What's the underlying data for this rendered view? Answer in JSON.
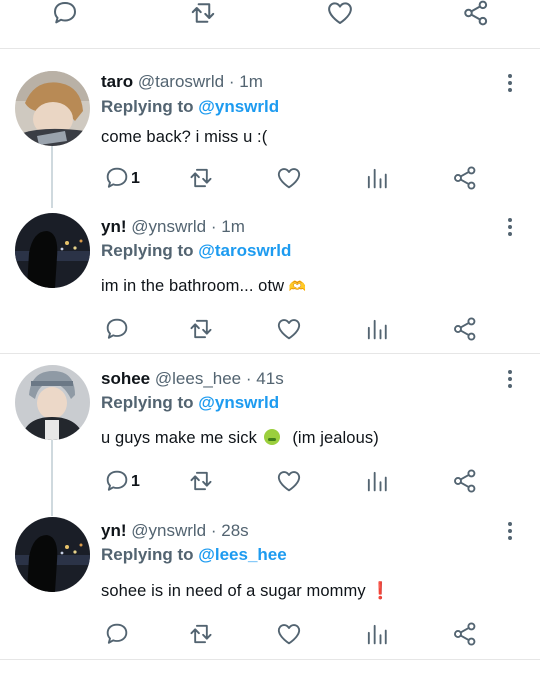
{
  "tweets": [
    {
      "name": "taro",
      "handle": "@taroswrld",
      "time": "1m",
      "reply_prefix": "Replying to",
      "reply_to": "@ynswrld",
      "text": "come back? i miss u :(",
      "reply_count": "1"
    },
    {
      "name": "yn!",
      "handle": "@ynswrld",
      "time": "1m",
      "reply_prefix": "Replying to",
      "reply_to": "@taroswrld",
      "text": "im in the bathroom... otw",
      "emoji": "🫶"
    },
    {
      "name": "sohee",
      "handle": "@lees_hee",
      "time": "41s",
      "reply_prefix": "Replying to",
      "reply_to": "@ynswrld",
      "text_before": "u guys make me sick",
      "emoji": "🤢",
      "text_after": "(im jealous)",
      "reply_count": "1"
    },
    {
      "name": "yn!",
      "handle": "@ynswrld",
      "time": "28s",
      "reply_prefix": "Replying to",
      "reply_to": "@lees_hee",
      "text": "sohee is in need of a sugar mommy",
      "emoji": "❗"
    }
  ],
  "separator": "·",
  "colors": {
    "text": "#0f1419",
    "secondary": "#536471",
    "link": "#1d9bf0",
    "thread": "#cfd9de"
  },
  "icons": [
    "reply-icon",
    "retweet-icon",
    "like-icon",
    "views-icon",
    "share-icon",
    "more-icon"
  ]
}
